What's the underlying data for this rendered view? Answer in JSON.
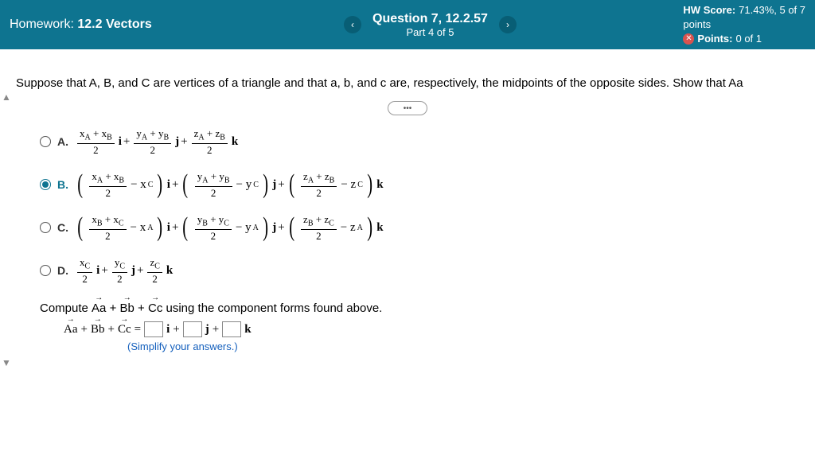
{
  "header": {
    "homework_label": "Homework:",
    "homework_title": "12.2 Vectors",
    "question_label": "Question 7, 12.2.57",
    "part_label": "Part 4 of 5",
    "hw_score_label": "HW Score:",
    "hw_score_value": "71.43%, 5 of 7",
    "points_word": "points",
    "points_label": "Points:",
    "points_value": "0 of 1"
  },
  "problem": {
    "text": "Suppose that A, B, and C are vertices of a triangle and that a, b, and c are, respectively, the midpoints of the opposite sides. Show that Aa"
  },
  "choices": {
    "a_label": "A.",
    "b_label": "B.",
    "c_label": "C.",
    "d_label": "D.",
    "selected": "B"
  },
  "compute": {
    "text_prefix": "Compute ",
    "text_suffix": " using the component forms found above.",
    "eq_lhs": "Aa + Bb + Cc =",
    "simplify": "(Simplify your answers.)"
  },
  "sym": {
    "i": "i",
    "j": "j",
    "k": "k",
    "plus": "+",
    "minus": "−",
    "xA": "x",
    "xB": "x",
    "xC": "x",
    "yA": "y",
    "yB": "y",
    "yC": "y",
    "zA": "z",
    "zB": "z",
    "zC": "z",
    "two": "2",
    "vecsum": "Aa + Bb + Cc"
  }
}
